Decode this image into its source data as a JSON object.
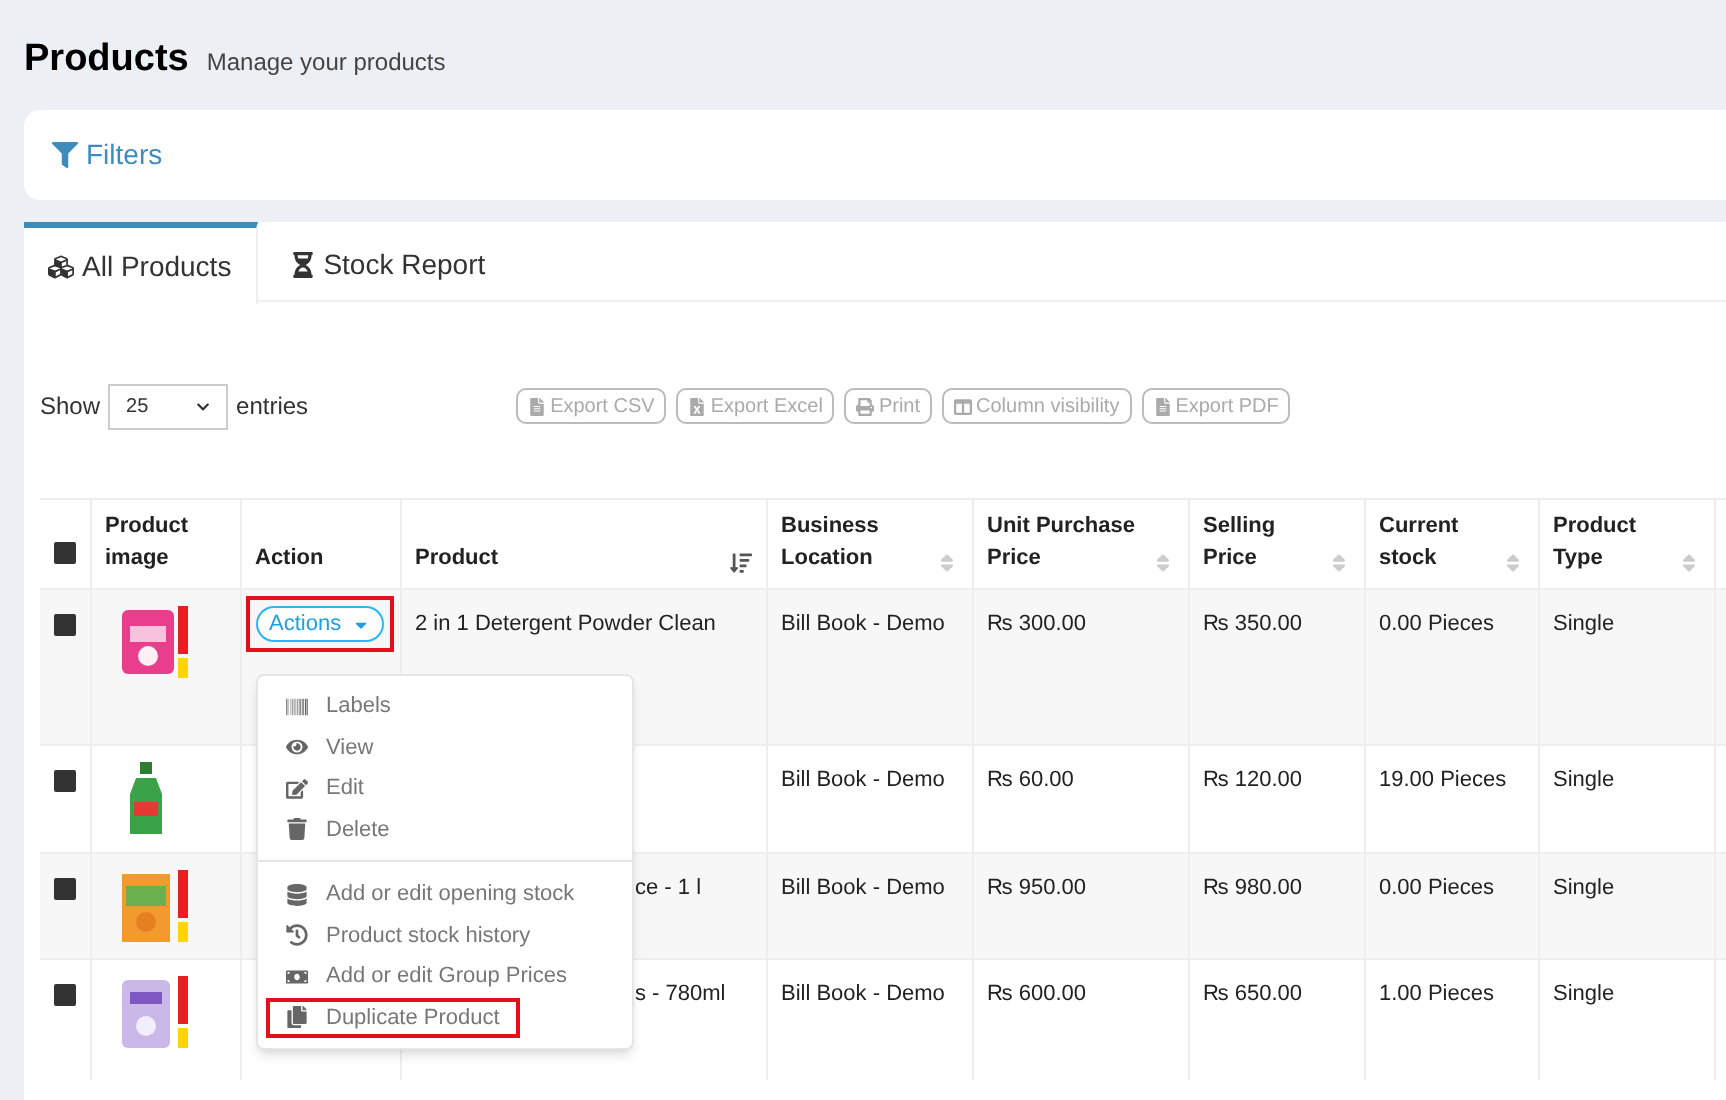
{
  "header": {
    "title": "Products",
    "subtitle": "Manage your products"
  },
  "filters": {
    "label": "Filters"
  },
  "tabs": [
    {
      "label": "All Products",
      "selected": true
    },
    {
      "label": "Stock Report",
      "selected": false
    }
  ],
  "length_control": {
    "label_before": "Show",
    "value": "25",
    "label_after": "entries"
  },
  "export_buttons": [
    {
      "label": "Export CSV"
    },
    {
      "label": "Export Excel"
    },
    {
      "label": "Print"
    },
    {
      "label": "Column visibility"
    },
    {
      "label": "Export PDF"
    }
  ],
  "table": {
    "select_all": {
      "checked": false
    },
    "columns": [
      {
        "label": "Product image"
      },
      {
        "label": "Action"
      },
      {
        "label": "Product"
      },
      {
        "label": "Business Location"
      },
      {
        "label": "Unit Purchase Price"
      },
      {
        "label": "Selling Price"
      },
      {
        "label": "Current stock"
      },
      {
        "label": "Product Type"
      }
    ],
    "rows": [
      {
        "checked": false,
        "product": "2 in 1 Detergent Powder Clean",
        "location": "Bill Book - Demo",
        "purchase": "₨ 300.00",
        "selling": "₨ 350.00",
        "stock": "0.00 Pieces",
        "type": "Single",
        "action": {
          "label": "Actions",
          "highlighted": true
        }
      },
      {
        "checked": false,
        "location": "Bill Book - Demo",
        "purchase": "₨ 60.00",
        "selling": "₨ 120.00",
        "stock": "19.00 Pieces",
        "type": "Single"
      },
      {
        "checked": false,
        "product": "ce - 1 l",
        "location": "Bill Book - Demo",
        "purchase": "₨ 950.00",
        "selling": "₨ 980.00",
        "stock": "0.00 Pieces",
        "type": "Single"
      },
      {
        "checked": false,
        "product": "s - 780ml",
        "location": "Bill Book - Demo",
        "purchase": "₨ 600.00",
        "selling": "₨ 650.00",
        "stock": "1.00 Pieces",
        "type": "Single"
      }
    ]
  },
  "action_menu": {
    "groups": [
      [
        {
          "label": "Labels",
          "highlighted": false
        },
        {
          "label": "View",
          "highlighted": false
        },
        {
          "label": "Edit",
          "highlighted": false
        },
        {
          "label": "Delete",
          "highlighted": false
        }
      ],
      [
        {
          "label": "Add or edit opening stock",
          "highlighted": false
        },
        {
          "label": "Product stock history",
          "highlighted": false
        },
        {
          "label": "Add or edit Group Prices",
          "highlighted": false
        },
        {
          "label": "Duplicate Product",
          "highlighted": true
        }
      ]
    ]
  }
}
